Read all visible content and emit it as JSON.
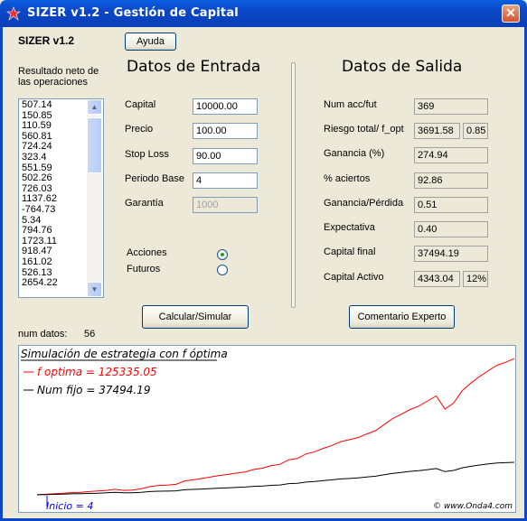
{
  "window": {
    "title": "SIZER v1.2 - Gestión de Capital",
    "close": "✕"
  },
  "app_label": "SIZER v1.2",
  "help_button": "Ayuda",
  "list_caption_1": "Resultado neto de",
  "list_caption_2": "las operaciones",
  "list_items": [
    "507.14",
    "150.85",
    "110.59",
    "560.81",
    "724.24",
    "323.4",
    "551.59",
    "502.26",
    "726.03",
    "1137.62",
    "-764.73",
    "5.34",
    "794.76",
    "1723.11",
    "918.47",
    "161.02",
    "526.13",
    "2654.22"
  ],
  "num_datos_label": "num datos:",
  "num_datos_value": "56",
  "entrada": {
    "heading": "Datos de Entrada",
    "capital_label": "Capital",
    "capital_value": "10000.00",
    "precio_label": "Precio",
    "precio_value": "100.00",
    "stop_label": "Stop Loss",
    "stop_value": "90.00",
    "periodo_label": "Periodo Base",
    "periodo_value": "4",
    "garantia_label": "Garantía",
    "garantia_value": "1000",
    "acciones_label": "Acciones",
    "futuros_label": "Futuros",
    "calc_button": "Calcular/Simular"
  },
  "salida": {
    "heading": "Datos de Salida",
    "num_label": "Num acc/fut",
    "num_value": "369",
    "riesgo_label": "Riesgo total/ f_opt",
    "riesgo_value": "3691.58",
    "fopt_value": "0.85",
    "ganancia_label": "Ganancia (%)",
    "ganancia_value": "274.94",
    "aciertos_label": "% aciertos",
    "aciertos_value": "92.86",
    "gp_label": "Ganancia/Pérdida",
    "gp_value": "0.51",
    "expectativa_label": "Expectativa",
    "expectativa_value": "0.40",
    "capfinal_label": "Capital final",
    "capfinal_value": "37494.19",
    "capactivo_label": "Capital Activo",
    "capactivo_value": "4343.04",
    "capactivo_pct": "12%",
    "comentario_button": "Comentario Experto"
  },
  "chart_data": {
    "type": "line",
    "title": "Simulación de estrategia con f óptima",
    "series": [
      {
        "name": "f optima = 125335.05",
        "color": "#ff0000",
        "values": [
          10000,
          10400,
          10900,
          11300,
          11800,
          12100,
          12700,
          13200,
          13700,
          14600,
          13700,
          14000,
          15100,
          16900,
          17900,
          18200,
          18800,
          21700,
          22600,
          23800,
          25100,
          26300,
          27200,
          28400,
          29400,
          31400,
          32600,
          34700,
          35800,
          39600,
          40700,
          44600,
          46400,
          49300,
          51800,
          55000,
          56700,
          58400,
          61500,
          64200,
          69400,
          74600,
          78300,
          82200,
          85100,
          89500,
          93700,
          82600,
          87600,
          98200,
          104600,
          110200,
          115100,
          119600,
          122200,
          125335.05
        ]
      },
      {
        "name": "Num fijo = 37494.19",
        "color": "#000000",
        "values": [
          10000,
          10200,
          10300,
          10500,
          10800,
          10900,
          11100,
          11300,
          11600,
          12000,
          11600,
          11700,
          12100,
          12700,
          13000,
          13100,
          13300,
          14200,
          14500,
          14800,
          15200,
          15600,
          15800,
          16200,
          16500,
          17100,
          17400,
          18000,
          18300,
          19400,
          19700,
          20700,
          21200,
          22000,
          22600,
          23400,
          23800,
          24300,
          25000,
          25700,
          26900,
          28100,
          28900,
          29800,
          30400,
          31300,
          32200,
          29600,
          30600,
          32800,
          34100,
          35200,
          36100,
          36900,
          37200,
          37494.19
        ]
      }
    ],
    "marker_label": "Inicio = 4",
    "credit": "© www.Onda4.com",
    "color_scheme": {
      "title_color": "#000000",
      "red": "#ff0000",
      "black": "#000000",
      "marker": "#0000ff"
    }
  }
}
